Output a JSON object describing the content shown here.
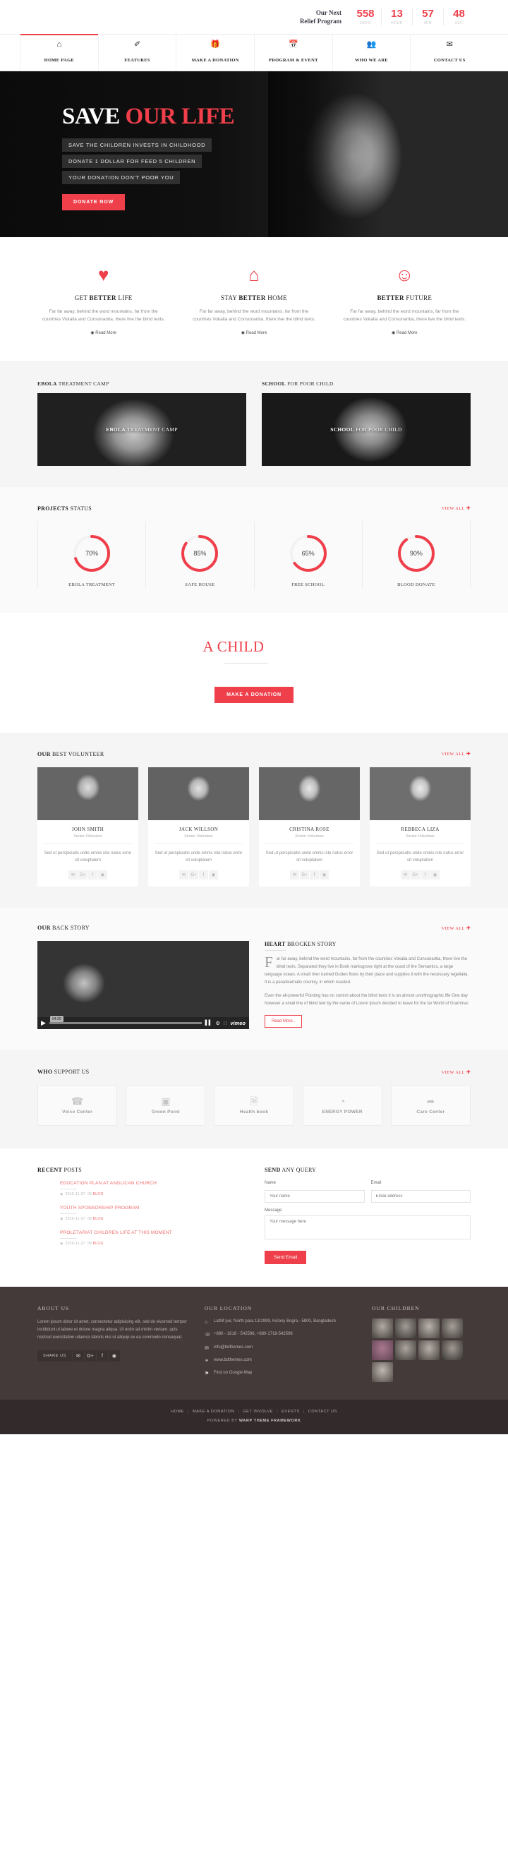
{
  "topbar": {
    "label_line1": "Our Next",
    "label_line2": "Relief Program",
    "countdown": [
      {
        "value": "558",
        "unit": "DAYS"
      },
      {
        "value": "13",
        "unit": "HOUR"
      },
      {
        "value": "57",
        "unit": "MIN"
      },
      {
        "value": "48",
        "unit": "SEC"
      }
    ]
  },
  "nav": {
    "items": [
      {
        "label": "HOME PAGE",
        "icon": "home-icon",
        "glyph": "⌂",
        "active": true
      },
      {
        "label": "FEATURES",
        "icon": "magic-icon",
        "glyph": "✐",
        "active": false
      },
      {
        "label": "MAKE A DONATION",
        "icon": "gift-icon",
        "glyph": "Ἰ1",
        "active": false
      },
      {
        "label": "PROGRAM & EVENT",
        "icon": "calendar-icon",
        "glyph": "Ὄ5",
        "active": false
      },
      {
        "label": "WHO WE ARE",
        "icon": "group-icon",
        "glyph": "὆5",
        "active": false
      },
      {
        "label": "CONTACT US",
        "icon": "envelope-icon",
        "glyph": "✉",
        "active": false
      }
    ]
  },
  "hero": {
    "title_white": "SAVE ",
    "title_red": "OUR LIFE",
    "lines": [
      "SAVE THE CHILDREN INVESTS IN CHILDHOOD",
      "DONATE 1 DOLLAR FOR FEED 5 CHILDREN",
      "YOUR DONATION DON'T POOR YOU"
    ],
    "cta": "DONATE NOW"
  },
  "features": [
    {
      "icon": "heart-icon",
      "glyph": "♥",
      "title_bold": "BETTER",
      "title_pre": "GET ",
      "title_post": " LIFE",
      "text": "Far far away, behind the word mountains, far from the countries Vokalia and Consonantia, there live the blind texts.",
      "readmore": "Read More"
    },
    {
      "icon": "home-icon",
      "glyph": "⌂",
      "title_bold": "BETTER",
      "title_pre": "STAY ",
      "title_post": " HOME",
      "text": "Far far away, behind the word mountains, far from the countries Vokalia and Consonantia, there live the blind texts.",
      "readmore": "Read More"
    },
    {
      "icon": "smiley-icon",
      "glyph": "☺",
      "title_bold": "BETTER",
      "title_pre": "",
      "title_post": " FUTURE",
      "text": "Far far away, behind the word mountains, far from the countries Vokalia and Consonantia, there live the blind texts.",
      "readmore": "Read More"
    }
  ],
  "camps": [
    {
      "head_bold": "EBOLA",
      "head_rest": " TREATMENT CAMP",
      "caption_bold": "EBOLA",
      "caption_rest": " TREATMENT CAMP"
    },
    {
      "head_bold": "SCHOOL",
      "head_rest": " FOR POOR CHILD",
      "caption_bold": "SCHOOL",
      "caption_rest": " FOR POOR CHILD"
    }
  ],
  "projects": {
    "title_bold": "PROJECTS",
    "title_rest": " STATUS",
    "viewall": "VIEW ALL"
  },
  "chart_data": {
    "type": "pie",
    "title": "PROJECTS STATUS",
    "categories": [
      "EBOLA TREATMENT",
      "SAFE HOUSE",
      "FREE SCHOOL",
      "BLOOD DONATE"
    ],
    "values": [
      70,
      85,
      65,
      90
    ],
    "value_labels": [
      "70%",
      "85%",
      "65%",
      "90%"
    ],
    "unit": "%",
    "ylim": [
      0,
      100
    ],
    "track_color": "#f2f2f2",
    "accent_color": "#ef3f4a",
    "legend": "none"
  },
  "cta_section": {
    "word": "A CHILD",
    "button": "MAKE A DONATION"
  },
  "volunteers": {
    "title_bold": "OUR",
    "title_rest": " BEST VOLUNTEER",
    "viewall": "VIEW ALL",
    "people": [
      {
        "name": "JOHN SMITH",
        "role": "Senior Volunteer",
        "text": "Sed ut perspiciatis unde omnis iste natus error sit voluptatem"
      },
      {
        "name": "JACK WILLSON",
        "role": "Senior Volunteer",
        "text": "Sed ut perspiciatis unde omnis iste natus error sit voluptatem"
      },
      {
        "name": "CRISTINA ROSE",
        "role": "Senior Volunteer",
        "text": "Sed ut perspiciatis unde omnis iste natus error sit voluptatem"
      },
      {
        "name": "REBBECA LIZA",
        "role": "Senior Volunteer",
        "text": "Sed ut perspiciatis unde omnis iste natus error sit voluptatem"
      }
    ],
    "social": [
      "✉",
      "G+",
      "f",
      "◉"
    ]
  },
  "backstory": {
    "title_bold": "OUR",
    "title_rest": " BACK STORY",
    "viewall": "VIEW ALL",
    "video": {
      "time": "04:20",
      "brand": "vimeo",
      "play": "▶"
    },
    "article_bold": "HEART",
    "article_rest": " BROCKEN STORY",
    "dropcap": "F",
    "paragraph1": "ar far away, behind the word mountains, far from the countries Vokalia and Consonantia, there live the blind texts. Separated they live in Book marksgrove right at the coast of the Semantics, a large language ocean. A small river named Duden flows by their place and supplies it with the necessary regelialia. It is a paradisematic country, in which roasted.",
    "paragraph2": "Even the all-powerful Pointing has no control about the blind texts it is an almost unorthographic life One day however a small line of blind text by the name of Lorem Ipsum decided to leave for the far World of Grammar.",
    "button": "Read More.."
  },
  "support": {
    "title_bold": "WHO",
    "title_rest": " SUPPORT US",
    "viewall": "VIEW ALL",
    "sponsors": [
      {
        "name": "Voice Center",
        "icon": "headset-icon",
        "glyph": "☎"
      },
      {
        "name": "Green Point",
        "icon": "monitor-icon",
        "glyph": "▣"
      },
      {
        "name": "Health book",
        "icon": "document-icon",
        "glyph": "὜E"
      },
      {
        "name": "ENERGY POWER",
        "icon": "bulb-icon",
        "glyph": "◔"
      },
      {
        "name": "Care Center",
        "icon": "swirl-icon",
        "glyph": "➦"
      }
    ]
  },
  "recent_posts": {
    "title_bold": "RECENT",
    "title_rest": " POSTS",
    "posts": [
      {
        "title": "EDUCATION PLAN AT ANGLICAN CHURCH",
        "date": "2016-11-27",
        "in": "IN",
        "category": "BLOG"
      },
      {
        "title": "YOUTH SPONSORSHIP PROGRAM",
        "date": "2016-11-27",
        "in": "IN",
        "category": "BLOG"
      },
      {
        "title": "PROLETARIAT CHILDREN LIFE AT THIS MOMENT",
        "date": "2016-11-27",
        "in": "IN",
        "category": "BLOG"
      }
    ]
  },
  "query_form": {
    "title_bold": "SEND",
    "title_rest": " ANY QUERY",
    "name_label": "Name",
    "name_placeholder": "Your name",
    "email_label": "Email",
    "email_placeholder": "Email address",
    "message_label": "Message",
    "message_placeholder": "Your message here",
    "submit": "Send Email"
  },
  "footer": {
    "about": {
      "title": "ABOUT US",
      "text": "Lorem ipsum dolor sit amet, consectetur adipisicing elit, sed do eiusmod tempor incididunt ut labore et dolore magna aliqua. Ut enim ad minim veniam, quis nostrud exercitation ullamco laboris nisi ut aliquip ex ea commodo consequat.",
      "share_label": "SHARE US",
      "social": [
        "✉",
        "G+",
        "f",
        "◉"
      ]
    },
    "location": {
      "title": "OUR LOCATION",
      "rows": [
        {
          "icon": "home-icon",
          "glyph": "⌂",
          "text": "Lathif pur, North para 13/1999, Kolony Bogra - 5800, Bangladesh"
        },
        {
          "icon": "phone-icon",
          "glyph": "☏",
          "text": "+880 - 1618 - 542596, +880-1718-542596"
        },
        {
          "icon": "mail-icon",
          "glyph": "✉",
          "text": "info@bdthemes.com"
        },
        {
          "icon": "link-icon",
          "glyph": "⚭",
          "text": "www.bdthemes.com"
        },
        {
          "icon": "pin-icon",
          "glyph": "⚑",
          "text": "Find on Google Map"
        }
      ]
    },
    "children": {
      "title": "OUR CHILDREN"
    },
    "bottom_nav": [
      "HOME",
      "MAKE A DONATION",
      "GET INVOLVE",
      "EVENTS",
      "CONTACT US"
    ],
    "credit_pre": "POWERED BY ",
    "credit_bold": "WARP THEME FRAMEWORK"
  }
}
